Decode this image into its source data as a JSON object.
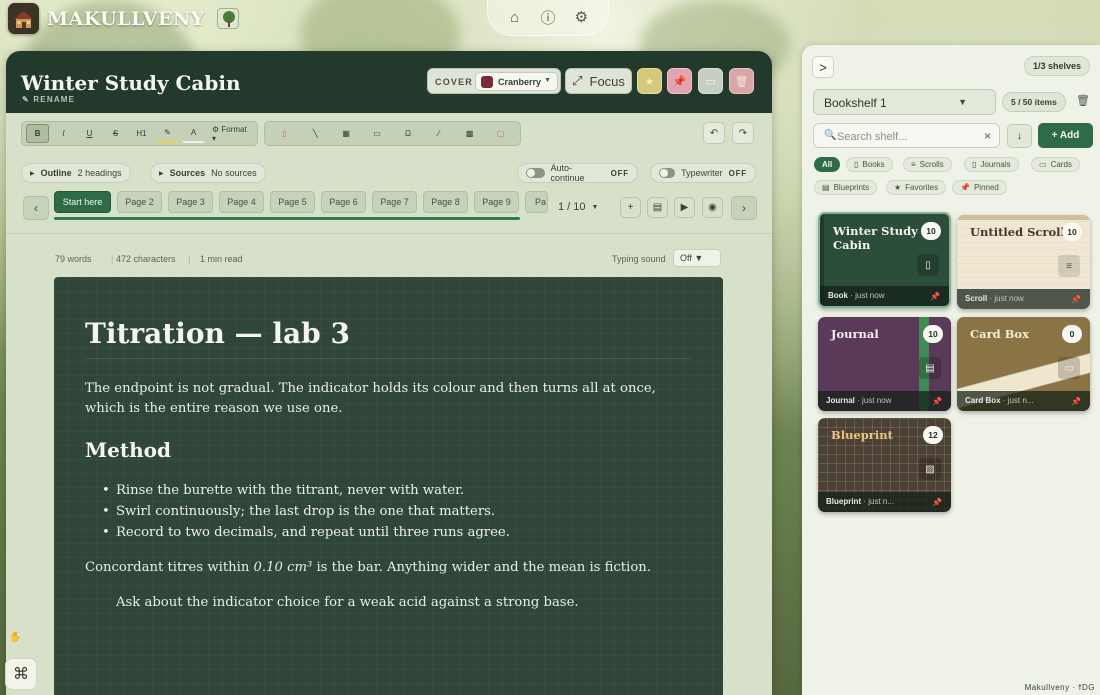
{
  "app": {
    "title": "MAKULLVENY",
    "footer": "Makullveny · ϯDG"
  },
  "nav": {
    "home": "home-icon",
    "info": "info-icon",
    "settings": "gear-icon"
  },
  "document": {
    "title": "Winter Study Cabin",
    "rename_label": "✎ RENAME",
    "cover_label": "COVER",
    "cover_value": "Cranberry",
    "cover_color": "#7a2a34",
    "focus_label": "Focus"
  },
  "toolbar": {
    "bold": "B",
    "italic": "I",
    "underline": "U",
    "strike": "S",
    "heading": "H1",
    "highlight": "✎",
    "text_color": "A",
    "format": "⚙ Format ▾",
    "insert_tools": [
      "▯",
      "╲",
      "▦",
      "▭",
      "Ω",
      "⁄",
      "▩",
      "▢"
    ],
    "undo": "↶",
    "redo": "↷"
  },
  "meta_row": {
    "outline_label": "Outline",
    "outline_value": "2 headings",
    "sources_label": "Sources",
    "sources_value": "No sources",
    "autocontinue_label": "Auto-continue",
    "autocontinue_state": "OFF",
    "typewriter_label": "Typewriter",
    "typewriter_state": "OFF"
  },
  "pages": {
    "tabs": [
      "Start here",
      "Page 2",
      "Page 3",
      "Page 4",
      "Page 5",
      "Page 6",
      "Page 7",
      "Page 8",
      "Page 9",
      "Pa"
    ],
    "indicator": "1 / 10",
    "progress": 1.0
  },
  "stats": {
    "words": "79 words",
    "characters": "472 characters",
    "read": "1 min read",
    "typing_label": "Typing sound",
    "typing_value": "Off ▼"
  },
  "content": {
    "h1": "Titration — lab 3",
    "p1": "The endpoint is not gradual. The indicator holds its colour and then turns all at once, which is the entire reason we use one.",
    "h2": "Method",
    "list": [
      "Rinse the burette with the titrant, never with water.",
      "Swirl continuously; the last drop is the one that matters.",
      "Record to two decimals, and repeat until three runs agree."
    ],
    "p2_pre": "Concordant titres within ",
    "p2_em": "0.10 cm³",
    "p2_post": " is the bar. Anything wider and the mean is fiction.",
    "p3": "Ask about the indicator choice for a weak acid against a strong base."
  },
  "shelf": {
    "toggle": ">",
    "shelves_count": "1/3 shelves",
    "name": "Bookshelf 1",
    "items_count": "5 / 50 items",
    "search_placeholder": "Search shelf...",
    "add_label": "+ Add",
    "sort_icon": "↓",
    "filters": [
      {
        "label": "All",
        "icon": ""
      },
      {
        "label": "Books",
        "icon": "▯"
      },
      {
        "label": "Scrolls",
        "icon": "≡"
      },
      {
        "label": "Journals",
        "icon": "▯"
      },
      {
        "label": "Cards",
        "icon": "▭"
      },
      {
        "label": "Blueprints",
        "icon": "▤"
      },
      {
        "label": "Favorites",
        "icon": "★"
      },
      {
        "label": "Pinned",
        "icon": "📌"
      }
    ],
    "items": [
      {
        "title": "Winter Study Cabin",
        "count": "10",
        "type": "Book",
        "time": "· just now",
        "icon": "▯"
      },
      {
        "title": "Untitled Scroll",
        "count": "10",
        "type": "Scroll",
        "time": "· just now",
        "icon": "≡"
      },
      {
        "title": "Journal",
        "count": "10",
        "type": "Journal",
        "time": "· just now",
        "icon": "▤"
      },
      {
        "title": "Card Box",
        "count": "0",
        "type": "Card Box",
        "time": "· just n...",
        "icon": "▭"
      },
      {
        "title": "Blueprint",
        "count": "12",
        "type": "Blueprint",
        "time": "· just n...",
        "icon": "▨"
      }
    ]
  }
}
